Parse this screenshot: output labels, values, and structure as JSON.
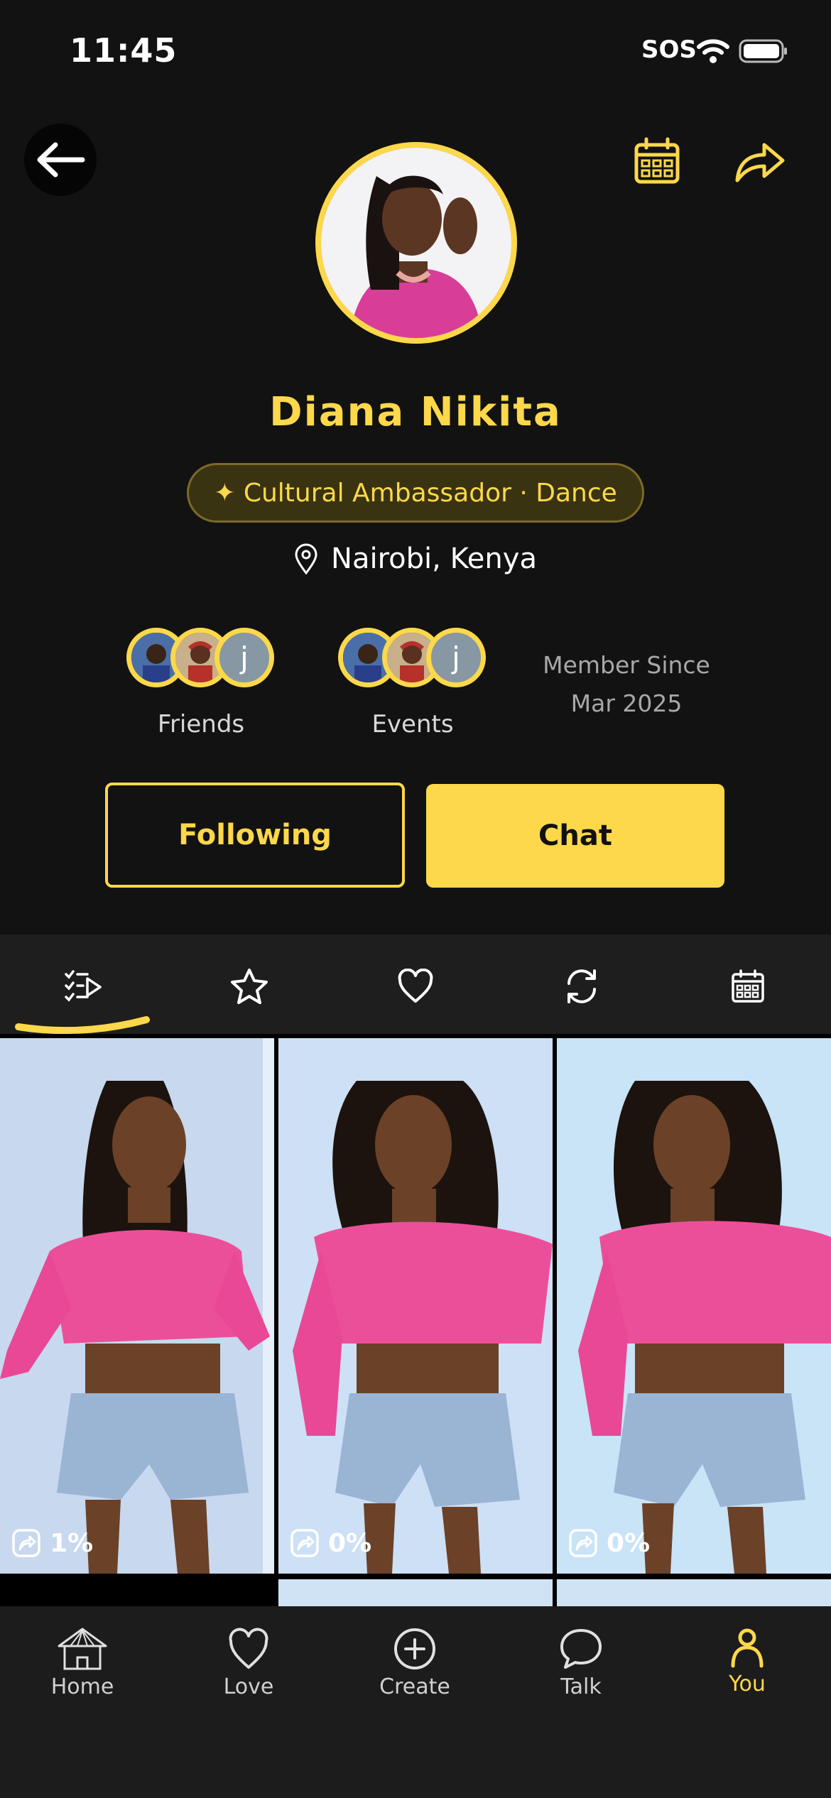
{
  "status_bar": {
    "time": "11:45",
    "carrier": "SOS"
  },
  "profile": {
    "name": "Diana Nikita",
    "badge": "✦ Cultural Ambassador · Dance",
    "location": "Nairobi, Kenya"
  },
  "stats": {
    "friends_label": "Friends",
    "events_label": "Events",
    "avatar_initial": "j",
    "member_since_label": "Member Since",
    "member_since_date": "Mar 2025"
  },
  "actions": {
    "following_label": "Following",
    "chat_label": "Chat"
  },
  "tabs": [
    "playlist-icon",
    "star-icon",
    "heart-icon",
    "repost-icon",
    "calendar-icon"
  ],
  "posts": [
    {
      "share_percent": "1%"
    },
    {
      "share_percent": "0%"
    },
    {
      "share_percent": "0%"
    }
  ],
  "bottom_nav": {
    "home": "Home",
    "love": "Love",
    "create": "Create",
    "talk": "Talk",
    "you": "You"
  },
  "colors": {
    "accent": "#fcd84a",
    "background": "#121212",
    "badge_bg": "#3a3312"
  }
}
